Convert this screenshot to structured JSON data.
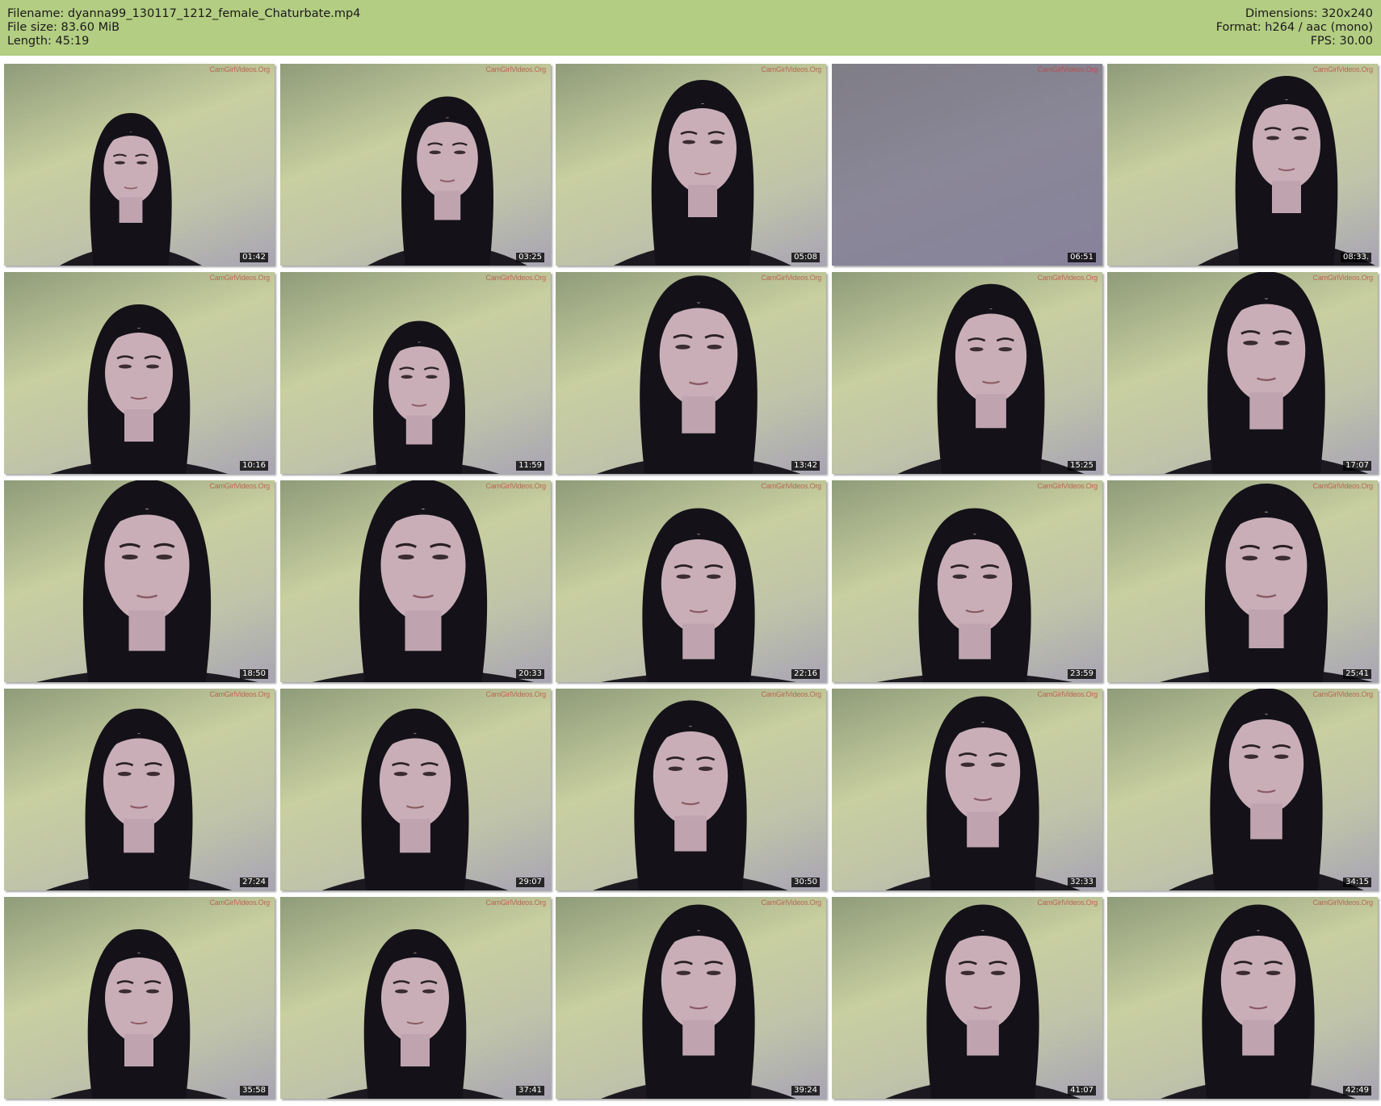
{
  "header": {
    "filename_label": "Filename:",
    "filename": "dyanna99_130117_1212_female_Chaturbate.mp4",
    "filesize_label": "File size:",
    "filesize": "83.60 MiB",
    "length_label": "Length:",
    "length": "45:19",
    "dimensions_label": "Dimensions:",
    "dimensions": "320x240",
    "format_label": "Format:",
    "format": "h264 / aac (mono)",
    "fps_label": "FPS:",
    "fps": "30.00"
  },
  "watermark": "CamGirlVideos.Org",
  "thumbnails": [
    {
      "time": "01:42"
    },
    {
      "time": "03:25"
    },
    {
      "time": "05:08"
    },
    {
      "time": "06:51"
    },
    {
      "time": "08:33."
    },
    {
      "time": "10:16"
    },
    {
      "time": "11:59"
    },
    {
      "time": "13:42"
    },
    {
      "time": "15:25"
    },
    {
      "time": "17:07"
    },
    {
      "time": "18:50"
    },
    {
      "time": "20:33"
    },
    {
      "time": "22:16"
    },
    {
      "time": "23:59"
    },
    {
      "time": "25:41"
    },
    {
      "time": "27:24"
    },
    {
      "time": "29:07"
    },
    {
      "time": "30:50"
    },
    {
      "time": "32:33"
    },
    {
      "time": "34:15"
    },
    {
      "time": "35:58"
    },
    {
      "time": "37:41"
    },
    {
      "time": "39:24"
    },
    {
      "time": "41:07"
    },
    {
      "time": "42:49"
    }
  ]
}
